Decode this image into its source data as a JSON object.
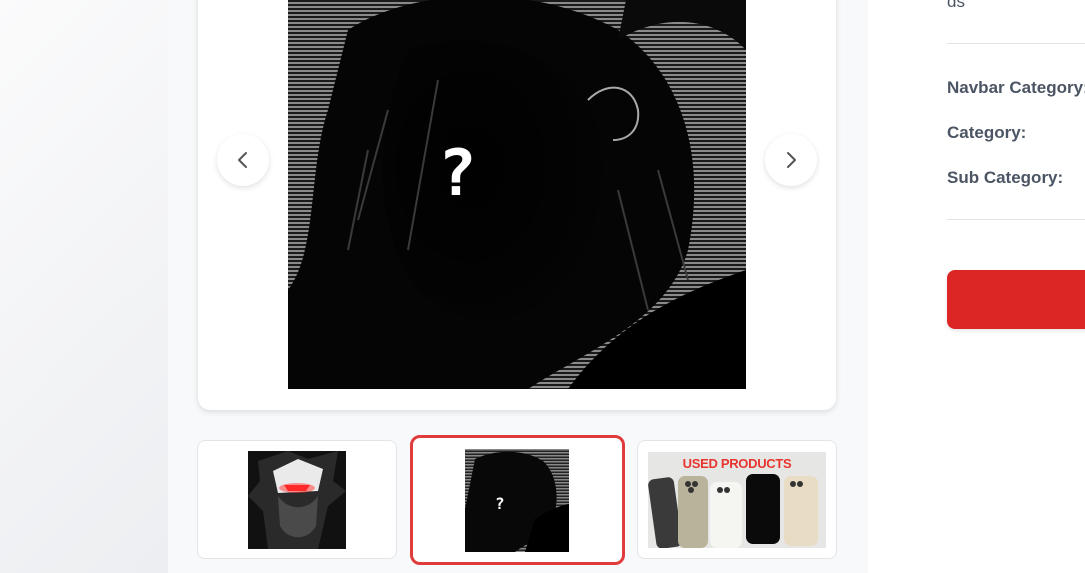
{
  "page": {
    "background": "#f5f6f8"
  },
  "gallery": {
    "prev_icon": "chevron-left-icon",
    "next_icon": "chevron-right-icon",
    "main_image": "Dark manga-style illustration of a figure with a question mark over the face",
    "thumbnails": [
      {
        "label": "Anime character with glowing red eyes",
        "active": false
      },
      {
        "label": "Dark manga character with question mark",
        "active": true
      },
      {
        "label": "Used products phones",
        "caption": "USED PRODUCTS",
        "active": false
      }
    ],
    "active_border_color": "#e03c3c"
  },
  "details": {
    "top_fragment": "ds",
    "navbar_category_label": "Navbar Category:",
    "category_label": "Category:",
    "sub_category_label": "Sub Category:",
    "cta_color": "#dc2626"
  }
}
